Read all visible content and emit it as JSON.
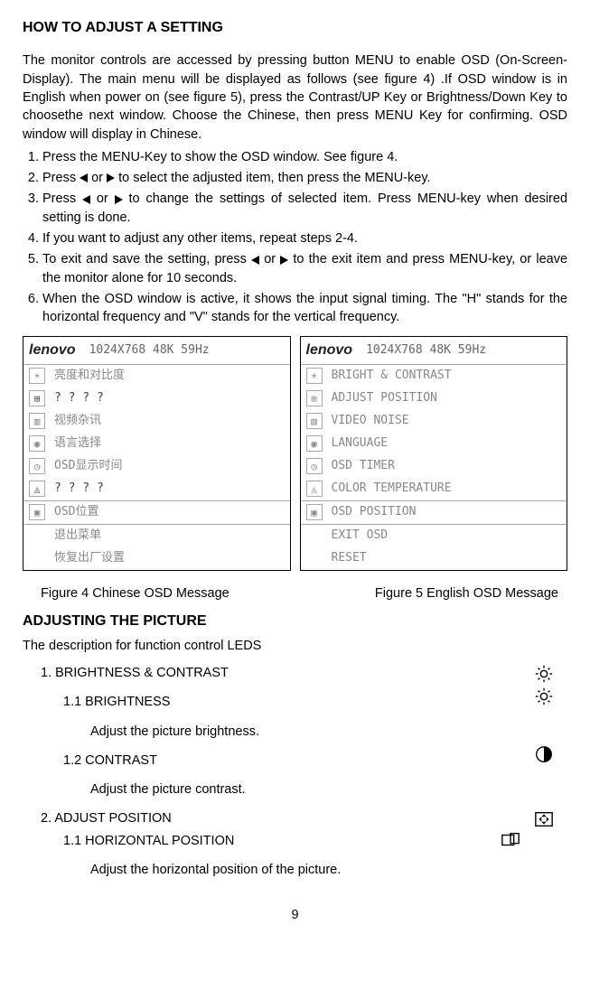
{
  "heading1": "HOW TO ADJUST A SETTING",
  "paragraph1": "The monitor controls are accessed by pressing button MENU to enable OSD (On-Screen-Display). The main menu will be displayed as follows (see figure 4) .If OSD window is in English when power on (see figure 5), press the Contrast/UP Key or Brightness/Down Key to choosethe next window. Choose the Chinese, then press MENU Key for confirming. OSD window will display in Chinese.",
  "steps": {
    "s1": "Press the MENU-Key to show the OSD window. See figure 4.",
    "s2a": "Press ",
    "s2b": " or ",
    "s2c": " to select the adjusted item, then press the MENU-key.",
    "s3a": "Press ",
    "s3b": " or ",
    "s3c": " to change the settings of selected item. Press MENU-key when desired setting is done.",
    "s4": "If you want to adjust any other items, repeat steps 2-4.",
    "s5a": "To exit and save the setting, press ",
    "s5b": " or ",
    "s5c": " to the exit item and press MENU-key, or leave the monitor alone for 10 seconds.",
    "s6": "When the OSD window is active, it shows the input signal timing. The  \"H\" stands for the horizontal frequency and \"V\" stands for the vertical frequency."
  },
  "fig4": {
    "logo": "lenovo",
    "header": "1024X768   48K   59Hz",
    "items": [
      "亮度和对比度",
      "? ? ? ?",
      "视频杂讯",
      "语言选择",
      "OSD显示时间",
      "? ? ? ?",
      "OSD位置",
      "退出菜单",
      "恢复出厂设置"
    ]
  },
  "fig5": {
    "logo": "lenovo",
    "header": "1024X768   48K   59Hz",
    "items": [
      "BRIGHT & CONTRAST",
      "ADJUST POSITION",
      "VIDEO NOISE",
      "LANGUAGE",
      "OSD TIMER",
      "COLOR TEMPERATURE",
      "OSD POSITION",
      "EXIT OSD",
      "RESET"
    ]
  },
  "caption4": "Figure 4 Chinese OSD Message",
  "caption5": "Figure 5  English OSD Message",
  "heading2": "ADJUSTING THE PICTURE",
  "desc2": "The description for function control LEDS",
  "item1": "1. BRIGHTNESS & CONTRAST",
  "item1_1": "1.1   BRIGHTNESS",
  "item1_1d": "Adjust the picture brightness.",
  "item1_2": "1.2   CONTRAST",
  "item1_2d": "Adjust the picture contrast.",
  "item2": "2.   ADJUST POSITION",
  "item2_1": "1.1  HORIZONTAL POSITION",
  "item2_1d": "Adjust the horizontal position of the picture.",
  "pagenum": "9"
}
